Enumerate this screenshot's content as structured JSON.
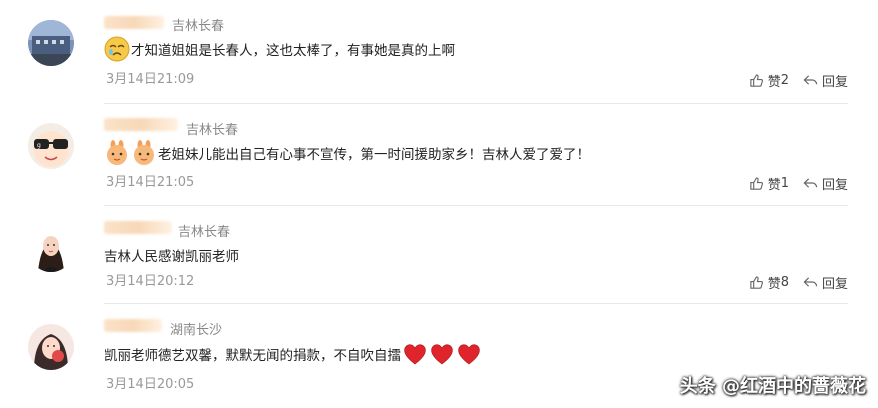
{
  "comments": [
    {
      "location": "吉林长春",
      "text": "才知道姐姐是长春人，这也太棒了，有事她是真的上啊",
      "date": "3月14日21:09",
      "like_label": "赞",
      "like_count": "2",
      "reply_label": "回复",
      "emoji": "crying-face"
    },
    {
      "location": "吉林长春",
      "text": "老姐妹儿能出自己有心事不宣传，第一时间援助家乡！吉林人爱了爱了！",
      "date": "3月14日21:05",
      "like_label": "赞",
      "like_count": "1",
      "reply_label": "回复",
      "emoji": "clapping-rabbit"
    },
    {
      "location": "吉林长春",
      "text": "吉林人民感谢凯丽老师",
      "date": "3月14日20:12",
      "like_label": "赞",
      "like_count": "8",
      "reply_label": "回复"
    },
    {
      "location": "湖南长沙",
      "text": "凯丽老师德艺双馨，默默无闻的捐款，不自吹自擂",
      "date": "3月14日20:05",
      "emoji": "red-heart"
    }
  ],
  "watermark": "头条 @红酒中的蔷薇花",
  "colors": {
    "heart": "#e0242b",
    "meta": "#999999",
    "location": "#888888"
  }
}
